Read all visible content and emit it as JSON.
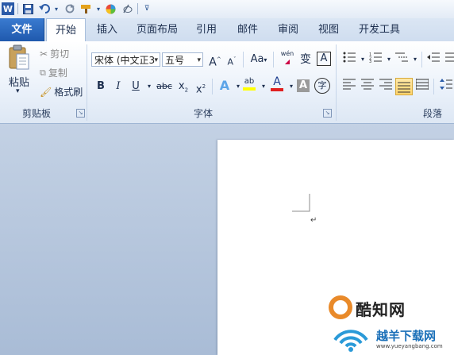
{
  "app": {
    "logo_letter": "W"
  },
  "quick_access": {
    "icons": [
      "word-logo-icon",
      "save-icon",
      "undo-icon",
      "redo-icon",
      "format-painter-icon",
      "color-icon",
      "clear-format-icon",
      "customize-icon"
    ]
  },
  "tabs": {
    "file": "文件",
    "home": "开始",
    "insert": "插入",
    "page_layout": "页面布局",
    "references": "引用",
    "mailings": "邮件",
    "review": "审阅",
    "view": "视图",
    "developer": "开发工具"
  },
  "clipboard": {
    "paste": "粘贴",
    "cut": "剪切",
    "copy": "复制",
    "format_painter": "格式刷",
    "group_label": "剪贴板"
  },
  "font": {
    "font_name": "宋体 (中文正3",
    "font_size": "五号",
    "grow": "A",
    "shrink": "A",
    "change_case": "Aa",
    "phonetic": "wén",
    "phonetic2": "变",
    "char_border": "A",
    "bold": "B",
    "italic": "I",
    "underline": "U",
    "strike": "abc",
    "subscript": "x",
    "superscript": "x",
    "text_effects": "A",
    "highlight": "ab",
    "font_color": "A",
    "char_shading": "A",
    "enclose": "字",
    "group_label": "字体"
  },
  "paragraph": {
    "group_label": "段落"
  },
  "colors": {
    "accent": "#1f59ad",
    "font_color_bar": "#e02020",
    "highlight_bar": "#ffff00"
  },
  "watermark": {
    "brand1": "酷知网",
    "brand2": "越羊下载网",
    "url": "www.yueyangbang.com"
  }
}
